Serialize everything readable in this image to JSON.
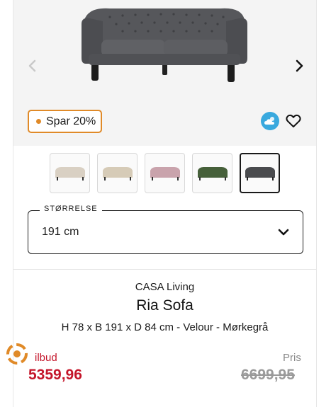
{
  "badge": {
    "label": "Spar 20%",
    "color": "#e08a28"
  },
  "hero": {
    "prev_icon": "chevron-left-icon",
    "next_icon": "chevron-right-icon"
  },
  "actions": {
    "weather_icon": "weather-cloud-sun-icon",
    "favorite_icon": "heart-outline-icon"
  },
  "color_variants": [
    {
      "name": "beige",
      "color": "#d9d0c3"
    },
    {
      "name": "cream",
      "color": "#d6cbb7"
    },
    {
      "name": "pink",
      "color": "#c9a3ac"
    },
    {
      "name": "green",
      "color": "#46603a"
    },
    {
      "name": "dark-grey",
      "color": "#4a4b4e",
      "selected": true
    }
  ],
  "size_select": {
    "label": "STØRRELSE",
    "value": "191 cm"
  },
  "product": {
    "brand": "CASA Living",
    "title": "Ria Sofa",
    "specs": "H 78 x B 191 x D 84 cm - Velour - Mørkegrå"
  },
  "price": {
    "offer_label": "ilbud",
    "offer_price": "5359,96",
    "regular_label": "Pris",
    "regular_price": "6699,95",
    "offer_color": "#c4152a"
  }
}
